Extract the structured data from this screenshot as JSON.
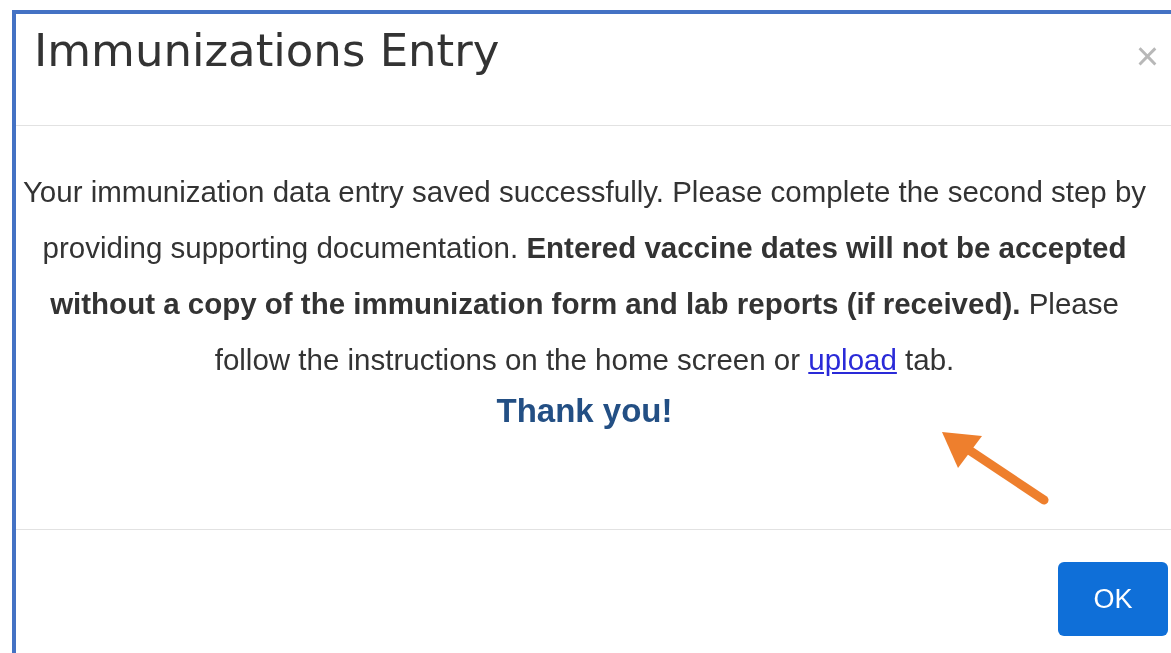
{
  "dialog": {
    "title": "Immunizations Entry",
    "close": "×",
    "message": {
      "text": "Your immunization data entry saved successfully. Please complete the second step by providing supporting documentation. **Entered vaccine dates will not be accepted without a copy of the immunization form and lab reports (if received).** Please follow the instructions on the home screen or",
      "link": "upload",
      "after": "tab."
    },
    "thanks": "Thank you!",
    "buttons": [
      "OK"
    ]
  }
}
